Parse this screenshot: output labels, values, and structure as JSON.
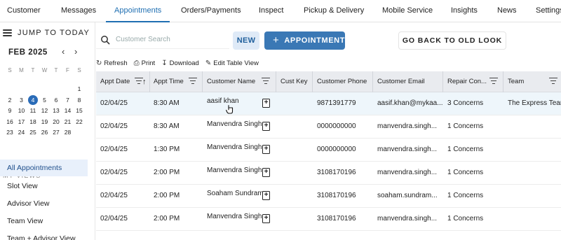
{
  "topnav": {
    "tabs": [
      "Customer",
      "Messages",
      "Appointments",
      "Orders/Payments",
      "Inspect",
      "Pickup & Delivery",
      "Mobile Service",
      "Insights",
      "News",
      "Settings"
    ]
  },
  "sidebar": {
    "jump_label": "JUMP TO TODAY",
    "month_label": "FEB 2025",
    "prev_icon": "chevron-left-icon",
    "next_icon": "chevron-right-icon",
    "weekdays": [
      "S",
      "M",
      "T",
      "W",
      "T",
      "F",
      "S"
    ],
    "weeks": [
      [
        "",
        "",
        "",
        "",
        "",
        "",
        "1"
      ],
      [
        "2",
        "3",
        "4",
        "5",
        "6",
        "7",
        "8"
      ],
      [
        "9",
        "10",
        "11",
        "12",
        "13",
        "14",
        "15"
      ],
      [
        "16",
        "17",
        "18",
        "19",
        "20",
        "21",
        "22"
      ],
      [
        "23",
        "24",
        "25",
        "26",
        "27",
        "28",
        ""
      ]
    ],
    "selected_day": "4",
    "my_views_label": "MY VIEWS",
    "views": [
      "All Appointments",
      "Slot View",
      "Advisor View",
      "Team View",
      "Team + Advisor View"
    ],
    "active_view": "All Appointments"
  },
  "toolbar": {
    "search_placeholder": "Customer Search",
    "new_label": "NEW",
    "appointment_label": "APPOINTMENT",
    "old_look_label": "GO BACK TO OLD LOOK",
    "refresh_label": "Refresh",
    "print_label": "Print",
    "download_label": "Download",
    "edit_view_label": "Edit Table View"
  },
  "table": {
    "columns": [
      "Appt Date",
      "Appt Time",
      "Customer Name",
      "Cust Key",
      "Customer Phone",
      "Customer Email",
      "Repair Con...",
      "Team"
    ],
    "rows": [
      {
        "date": "02/04/25",
        "time": "8:30 AM",
        "name": "aasif khan",
        "key": "",
        "phone": "9871391779",
        "email": "aasif.khan@mykaa...",
        "repair": "3 Concerns",
        "team": "The Express Team"
      },
      {
        "date": "02/04/25",
        "time": "8:30 AM",
        "name": "Manvendra Singh",
        "key": "",
        "phone": "0000000000",
        "email": "manvendra.singh...",
        "repair": "1 Concerns",
        "team": ""
      },
      {
        "date": "02/04/25",
        "time": "1:30 PM",
        "name": "Manvendra Singh",
        "key": "",
        "phone": "0000000000",
        "email": "manvendra.singh...",
        "repair": "1 Concerns",
        "team": ""
      },
      {
        "date": "02/04/25",
        "time": "2:00 PM",
        "name": "Manvendra Singh",
        "key": "",
        "phone": "3108170196",
        "email": "manvendra.singh...",
        "repair": "1 Concerns",
        "team": ""
      },
      {
        "date": "02/04/25",
        "time": "2:00 PM",
        "name": "Soaham Sundram",
        "key": "",
        "phone": "3108170196",
        "email": "soaham.sundram...",
        "repair": "1 Concerns",
        "team": ""
      },
      {
        "date": "02/04/25",
        "time": "2:00 PM",
        "name": "Manvendra Singh",
        "key": "",
        "phone": "3108170196",
        "email": "manvendra.singh...",
        "repair": "1 Concerns",
        "team": ""
      }
    ]
  },
  "colors": {
    "accent": "#1f6fb2",
    "primary_button": "#3a78b5",
    "new_button_bg": "#dfeaf7",
    "header_bg": "#e9ebef",
    "selected_row": "#eef6fb",
    "selected_day": "#2a6cb8"
  }
}
